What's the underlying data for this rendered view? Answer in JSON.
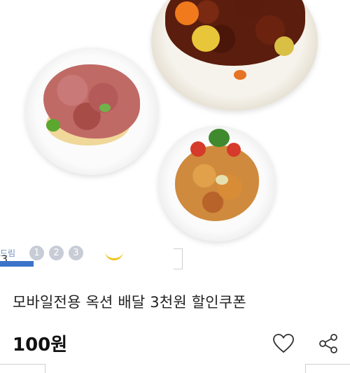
{
  "product": {
    "title": "모바일전용 옥션 배달 3천원 할인쿠폰",
    "price": "100원"
  },
  "carousel": {
    "label": "드림",
    "dots": [
      "1",
      "2",
      "3"
    ],
    "count": "3"
  },
  "icons": {
    "like": "heart-icon",
    "share": "share-icon"
  },
  "colors": {
    "indicator_bar": "#3b74c9",
    "dot": "#c8ccd6",
    "accent_arc": "#f2c21a"
  }
}
